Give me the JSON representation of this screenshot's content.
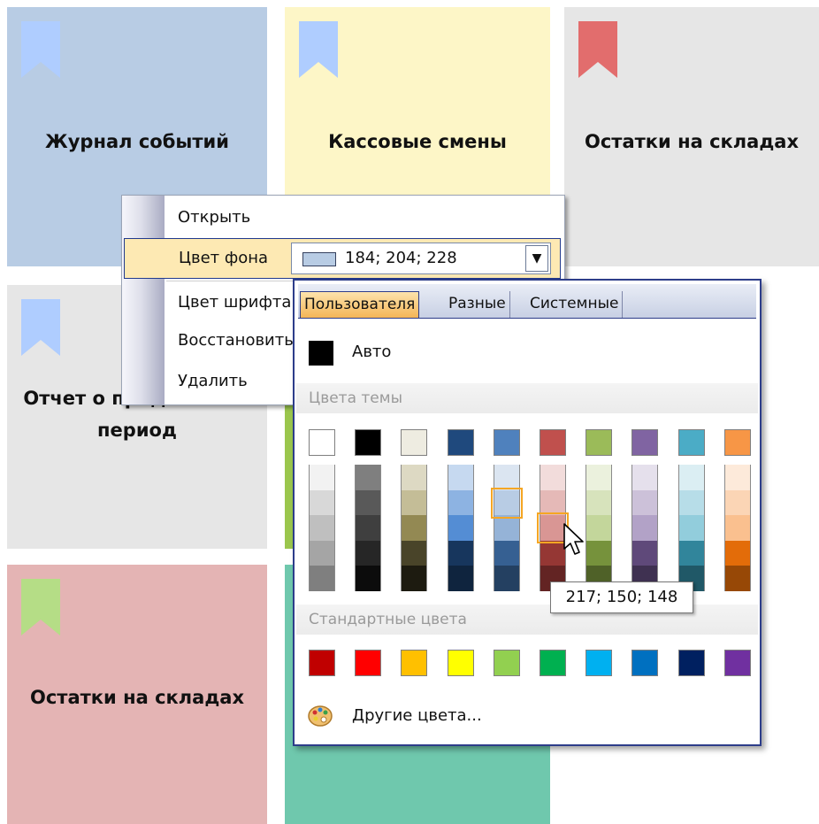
{
  "tiles": [
    {
      "id": "t1",
      "title": "Журнал событий",
      "bg": "#b8cce4",
      "bookmark": "#afcdff",
      "title_top": "130"
    },
    {
      "id": "t2",
      "title": "Кассовые смены",
      "bg": "#fdf6c7",
      "bookmark": "#afcdff"
    },
    {
      "id": "t3",
      "title": "Остатки на складах",
      "bg": "#e6e6e6",
      "bookmark": "#e26d6d"
    },
    {
      "id": "t4",
      "title": "Отчет о продажах за период",
      "bg": "#e6e6e6",
      "bookmark": "#afcdff"
    },
    {
      "id": "t5",
      "title": "",
      "bg": "#9bc64d",
      "bookmark": ""
    },
    {
      "id": "t6",
      "title": "Остатки на складах",
      "bg": "#e4b4b4",
      "bookmark": "#b5dd86"
    },
    {
      "id": "t7",
      "title": "",
      "bg": "#6fc8ad",
      "bookmark": ""
    }
  ],
  "context_menu": {
    "open": "Открыть",
    "bg_color": "Цвет фона",
    "bg_color_value": "184; 204; 228",
    "font_color": "Цвет шрифта",
    "restore": "Восстановить",
    "delete": "Удалить"
  },
  "palette": {
    "tabs": [
      "Пользователя",
      "Разные",
      "Системные"
    ],
    "active_tab": "Пользователя",
    "auto": "Авто",
    "theme_colors_label": "Цвета темы",
    "standard_colors_label": "Стандартные цвета",
    "other_colors": "Другие цвета...",
    "theme_top": [
      "#ffffff",
      "#000000",
      "#eeece1",
      "#1f497d",
      "#4f81bd",
      "#c0504d",
      "#9bbb59",
      "#8064a2",
      "#4bacc6",
      "#f79646"
    ],
    "theme_shades": [
      [
        "#f2f2f2",
        "#d8d8d8",
        "#bfbfbf",
        "#a5a5a5",
        "#7f7f7f"
      ],
      [
        "#7f7f7f",
        "#595959",
        "#3f3f3f",
        "#262626",
        "#0c0c0c"
      ],
      [
        "#ddd9c3",
        "#c4bd97",
        "#938953",
        "#494429",
        "#1d1b10"
      ],
      [
        "#c6d9f0",
        "#8db3e2",
        "#548dd4",
        "#17365d",
        "#0f243e"
      ],
      [
        "#dbe5f1",
        "#b8cce4",
        "#95b3d7",
        "#366092",
        "#244061"
      ],
      [
        "#f2dcdb",
        "#e5b9b7",
        "#d99694",
        "#953734",
        "#632423"
      ],
      [
        "#ebf1dd",
        "#d7e3bc",
        "#c3d69b",
        "#76923c",
        "#4f6128"
      ],
      [
        "#e5e0ec",
        "#ccc1d9",
        "#b2a2c7",
        "#5f497a",
        "#3f3151"
      ],
      [
        "#dbeef3",
        "#b7dde8",
        "#92cddc",
        "#31859b",
        "#205867"
      ],
      [
        "#fdeada",
        "#fbd5b5",
        "#fac08f",
        "#e36c09",
        "#974806"
      ]
    ],
    "standard": [
      "#c00000",
      "#ff0000",
      "#ffc000",
      "#ffff00",
      "#92d050",
      "#00b050",
      "#00b0f0",
      "#0070c0",
      "#002060",
      "#7030a0"
    ],
    "selected_color": "184; 204; 228",
    "hover_color": "217; 150; 148"
  },
  "tooltip": "217; 150; 148"
}
